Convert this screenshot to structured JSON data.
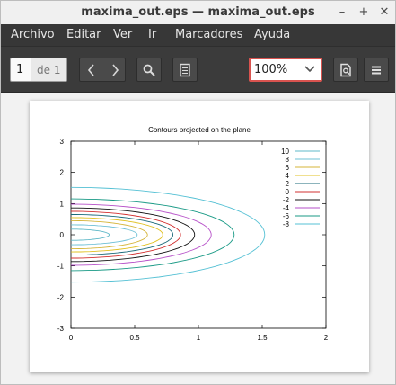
{
  "window": {
    "title": "maxima_out.eps — maxima_out.eps",
    "controls": [
      "–",
      "+",
      "✕"
    ]
  },
  "menubar": {
    "items": [
      "Archivo",
      "Editar",
      "Ver",
      "Ir",
      "Marcadores",
      "Ayuda"
    ]
  },
  "toolbar": {
    "page_value": "1",
    "page_of": "de 1",
    "zoom_value": "100%",
    "icons": [
      "chevron-left-icon",
      "chevron-right-icon",
      "search-icon",
      "document-icon",
      "zoom-dropdown-icon",
      "view-icon",
      "hamburger-menu-icon"
    ]
  },
  "chart_data": {
    "type": "line",
    "title": "Contours projected on the plane",
    "xlabel": "",
    "ylabel": "",
    "xlim": [
      0,
      2
    ],
    "ylim": [
      -3,
      3
    ],
    "xticks": [
      "0",
      "0.5",
      "1",
      "1.5",
      "2"
    ],
    "yticks": [
      "3",
      "2",
      "1",
      "0",
      "-1",
      "-2",
      "-3"
    ],
    "grid": false,
    "legend_position": "top-right",
    "series": [
      {
        "name": "10",
        "color": "#5fb8c8",
        "a": 0.3,
        "b": 0.18
      },
      {
        "name": "8",
        "color": "#6ec0d6",
        "a": 0.52,
        "b": 0.32
      },
      {
        "name": "6",
        "color": "#d5b53a",
        "a": 0.6,
        "b": 0.45
      },
      {
        "name": "4",
        "color": "#e0c020",
        "a": 0.72,
        "b": 0.55
      },
      {
        "name": "2",
        "color": "#1a6a7a",
        "a": 0.8,
        "b": 0.65
      },
      {
        "name": "0",
        "color": "#d23030",
        "a": 0.86,
        "b": 0.75
      },
      {
        "name": "-2",
        "color": "#111111",
        "a": 0.97,
        "b": 0.86
      },
      {
        "name": "-4",
        "color": "#b64fc8",
        "a": 1.1,
        "b": 0.98
      },
      {
        "name": "-6",
        "color": "#1a9a86",
        "a": 1.28,
        "b": 1.15
      },
      {
        "name": "-8",
        "color": "#54c0d4",
        "a": 1.52,
        "b": 1.52
      }
    ]
  }
}
